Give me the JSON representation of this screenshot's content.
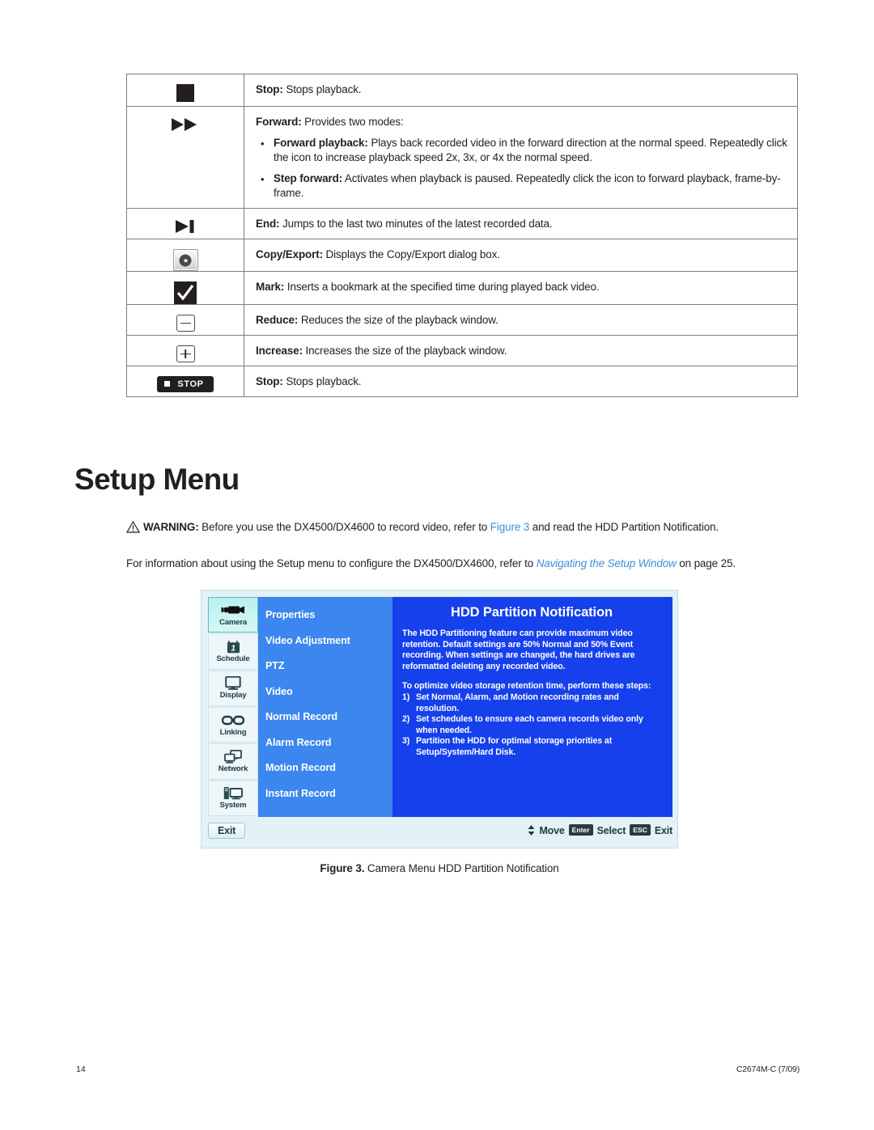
{
  "table": {
    "rows": [
      {
        "icon": "stop-square-icon",
        "term": "Stop:",
        "text": " Stops playback."
      },
      {
        "icon": "fast-forward-icon",
        "term": "Forward:",
        "text": " Provides two modes:",
        "bullets": [
          {
            "term": "Forward playback:",
            "text": " Plays back recorded video in the forward direction at the normal speed. Repeatedly click the icon to increase playback speed 2x, 3x, or 4x the normal speed."
          },
          {
            "term": "Step forward:",
            "text": " Activates when playback is paused. Repeatedly click the icon to forward playback, frame-by-frame."
          }
        ]
      },
      {
        "icon": "skip-to-end-icon",
        "term": "End:",
        "text": " Jumps to the last two minutes of the latest recorded data."
      },
      {
        "icon": "copy-export-disc-icon",
        "term": "Copy/Export:",
        "text": " Displays the Copy/Export dialog box."
      },
      {
        "icon": "mark-checkmark-icon",
        "term": "Mark:",
        "text": " Inserts a bookmark at the specified time during played back video."
      },
      {
        "icon": "minus-button-icon",
        "term": "Reduce:",
        "text": " Reduces the size of the playback window."
      },
      {
        "icon": "plus-button-icon",
        "term": "Increase:",
        "text": " Increases the size of the playback window."
      },
      {
        "icon": "stop-button-icon",
        "icon_label": "STOP",
        "term": "Stop:",
        "text": " Stops playback."
      }
    ]
  },
  "heading": "Setup Menu",
  "warning": {
    "icon": "warning-triangle-icon",
    "label": "WARNING:",
    "text_before": " Before you use the DX4500/DX4600 to record video, refer to ",
    "link": "Figure 3",
    "text_after": " and read the HDD Partition Notification."
  },
  "info_paragraph": {
    "text_before": "For information about using the Setup menu to configure the DX4500/DX4600, refer to ",
    "link": "Navigating the Setup Window",
    "text_after": " on page 25."
  },
  "figure": {
    "sidebar": [
      {
        "label": "Camera",
        "icon": "camcorder-icon",
        "active": true
      },
      {
        "label": "Schedule",
        "icon": "calendar-icon",
        "active": false
      },
      {
        "label": "Display",
        "icon": "monitor-icon",
        "active": false
      },
      {
        "label": "Linking",
        "icon": "chain-link-icon",
        "active": false
      },
      {
        "label": "Network",
        "icon": "two-monitors-icon",
        "active": false
      },
      {
        "label": "System",
        "icon": "tower-monitor-icon",
        "active": false
      }
    ],
    "menu_items": [
      "Properties",
      "Video Adjustment",
      "PTZ",
      "Video",
      "Normal Record",
      "Alarm Record",
      "Motion Record",
      "Instant Record"
    ],
    "panel": {
      "title": "HDD Partition Notification",
      "paragraph1": "The HDD Partitioning feature can provide maximum video retention. Default settings are 50% Normal and 50% Event recording. When settings are changed, the hard drives are reformatted deleting any recorded video.",
      "paragraph2": "To optimize video storage retention time, perform these steps:",
      "steps": [
        {
          "num": "1)",
          "text": "Set Normal, Alarm, and Motion recording rates and resolution."
        },
        {
          "num": "2)",
          "text": "Set schedules to ensure each camera records video only when needed."
        },
        {
          "num": "3)",
          "text": "Partition the HDD for optimal storage priorities at Setup/System/Hard Disk."
        }
      ]
    },
    "footer": {
      "exit_label": "Exit",
      "move_label": "Move",
      "enter_key": "Enter",
      "select_label": "Select",
      "esc_key": "ESC",
      "exit_hint_label": "Exit"
    },
    "colors": {
      "panel_blue": "#1540ec",
      "menu_blue": "#3b86ef",
      "chrome": "#e3f2f6",
      "active_tab": "#b9f0ee"
    }
  },
  "figure_caption": {
    "label": "Figure 3.",
    "text": " Camera Menu HDD Partition Notification"
  },
  "footer": {
    "page_number": "14",
    "doc_code": "C2674M-C (7/09)"
  }
}
